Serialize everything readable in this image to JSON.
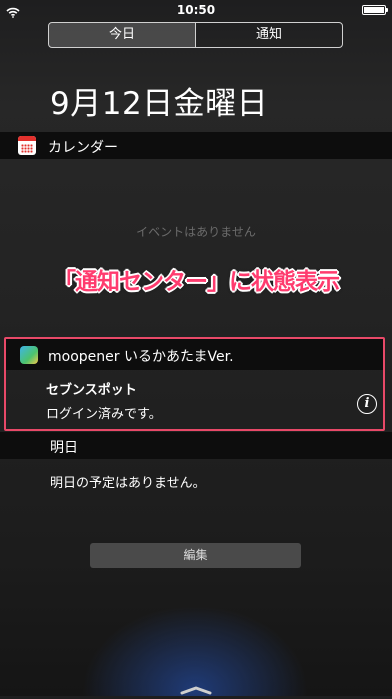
{
  "status_bar": {
    "time": "10:50",
    "wifi_icon": "wifi-icon",
    "battery_icon": "battery-icon"
  },
  "tabs": [
    {
      "label": "今日",
      "selected": true
    },
    {
      "label": "通知",
      "selected": false
    }
  ],
  "date_heading": "9月12日金曜日",
  "calendar_section": {
    "icon": "calendar-icon",
    "title": "カレンダー",
    "empty_message": "イベントはありません"
  },
  "banner": "「通知センター」に状態表示",
  "widget": {
    "app_icon": "app-icon",
    "app_name": "moopener いるかあたまVer.",
    "title": "セブンスポット",
    "status": "ログイン済みです。",
    "info_icon": "info-icon",
    "info_glyph": "i",
    "highlight_color": "#e84968"
  },
  "tomorrow_section": {
    "title": "明日",
    "message": "明日の予定はありません。"
  },
  "edit_button": {
    "label": "編集"
  },
  "colors": {
    "calendar_red": "#e3312d",
    "banner_pink": "#ff3b6e"
  }
}
